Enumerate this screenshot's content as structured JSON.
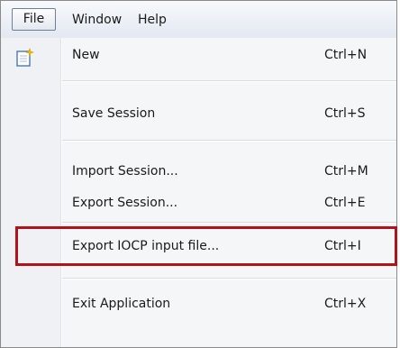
{
  "menubar": {
    "file": "File",
    "window": "Window",
    "help": "Help"
  },
  "menu": {
    "items": [
      {
        "label": "New",
        "shortcut": "Ctrl+N",
        "icon": "new-document-icon"
      },
      {
        "label": "Save Session",
        "shortcut": "Ctrl+S"
      },
      {
        "label": "Import Session...",
        "shortcut": "Ctrl+M"
      },
      {
        "label": "Export Session...",
        "shortcut": "Ctrl+E"
      },
      {
        "label": "Export IOCP input file...",
        "shortcut": "Ctrl+I"
      },
      {
        "label": "Exit Application",
        "shortcut": "Ctrl+X"
      }
    ]
  },
  "colors": {
    "highlight_border": "#b3121b",
    "menubar_bg": "#e3e8f1"
  }
}
